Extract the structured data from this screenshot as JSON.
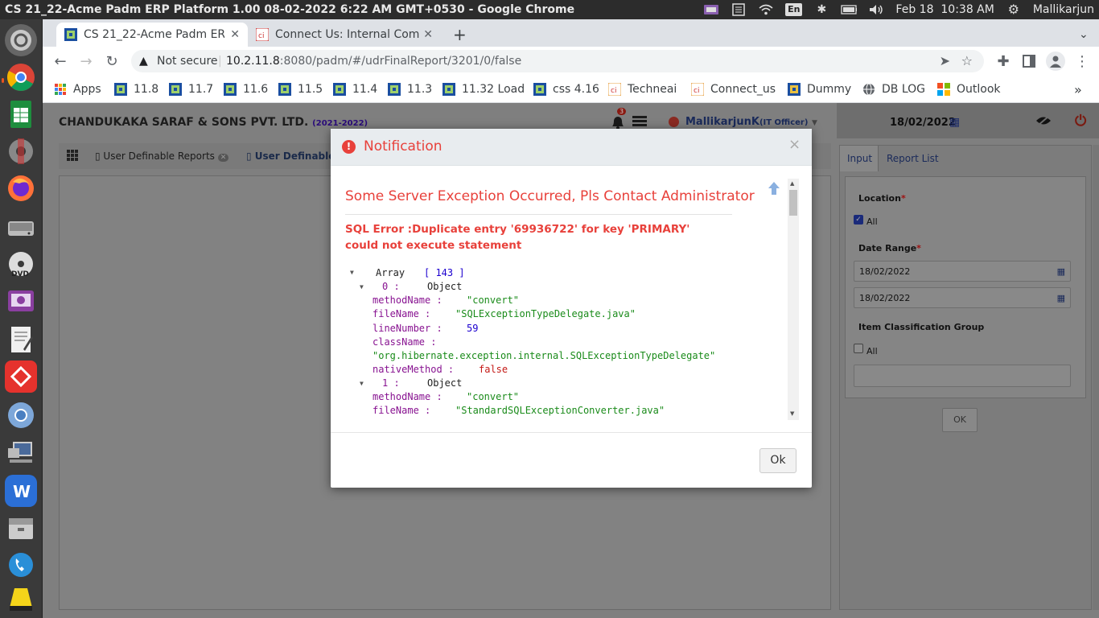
{
  "os": {
    "window_title": "CS 21_22-Acme Padm ERP Platform 1.00 08-02-2022 6:22 AM GMT+0530 - Google Chrome",
    "keyboard_layout": "En",
    "datetime": "Feb 18  10:38 AM",
    "user": "Mallikarjun"
  },
  "browser": {
    "tabs": [
      {
        "label": "CS 21_22-Acme Padm ERP",
        "active": true
      },
      {
        "label": "Connect Us: Internal Com",
        "active": false
      }
    ],
    "security": "Not secure",
    "url_host": "10.2.11.8",
    "url_rest": ":8080/padm/#/udrFinalReport/3201/0/false",
    "bookmarks": [
      "Apps",
      "11.8",
      "11.7",
      "11.6",
      "11.5",
      "11.4",
      "11.3",
      "11.32 Load",
      "css 4.16",
      "Techneai",
      "Connect_us",
      "Dummy",
      "DB LOG",
      "Outlook"
    ]
  },
  "app": {
    "company": "CHANDUKAKA SARAF & SONS PVT. LTD.",
    "fy": "(2021-2022)",
    "notification_count": "3",
    "user_name": "MallikarjunK",
    "user_role": "(IT Officer)",
    "date": "18/02/2022",
    "page_tabs": [
      "User Definable Reports",
      "User Definable"
    ],
    "side_tabs": [
      "Input",
      "Report List"
    ],
    "form": {
      "location_label": "Location",
      "all_label": "All",
      "date_range_label": "Date Range",
      "date_from": "18/02/2022",
      "date_to": "18/02/2022",
      "item_class_label": "Item Classification Group",
      "all_label2": "All",
      "ok_label": "OK"
    }
  },
  "modal": {
    "title": "Notification",
    "close": "×",
    "heading": "Some Server Exception Occurred, Pls Contact Administrator",
    "error_line1": "SQL Error :Duplicate entry '69936722' for key 'PRIMARY'",
    "error_line2": "could not execute statement",
    "trace": {
      "array_label": "Array",
      "array_count": "[ 143 ]",
      "idx0": "0 :",
      "obj": "Object",
      "methodName_key": "methodName :",
      "methodName_0": "\"convert\"",
      "fileName_key": "fileName :",
      "fileName_0": "\"SQLExceptionTypeDelegate.java\"",
      "lineNumber_key": "lineNumber :",
      "lineNumber_0": "59",
      "className_key": "className :",
      "className_0": "\"org.hibernate.exception.internal.SQLExceptionTypeDelegate\"",
      "nativeMethod_key": "nativeMethod :",
      "nativeMethod_0": "false",
      "idx1": "1 :",
      "methodName_1": "\"convert\"",
      "fileName_1": "\"StandardSQLExceptionConverter.java\""
    },
    "ok_label": "Ok"
  },
  "colors": {
    "error_red": "#e8413b",
    "dock_bg": "#3a3a3a",
    "overlay_gray": "#7f7f7f"
  }
}
